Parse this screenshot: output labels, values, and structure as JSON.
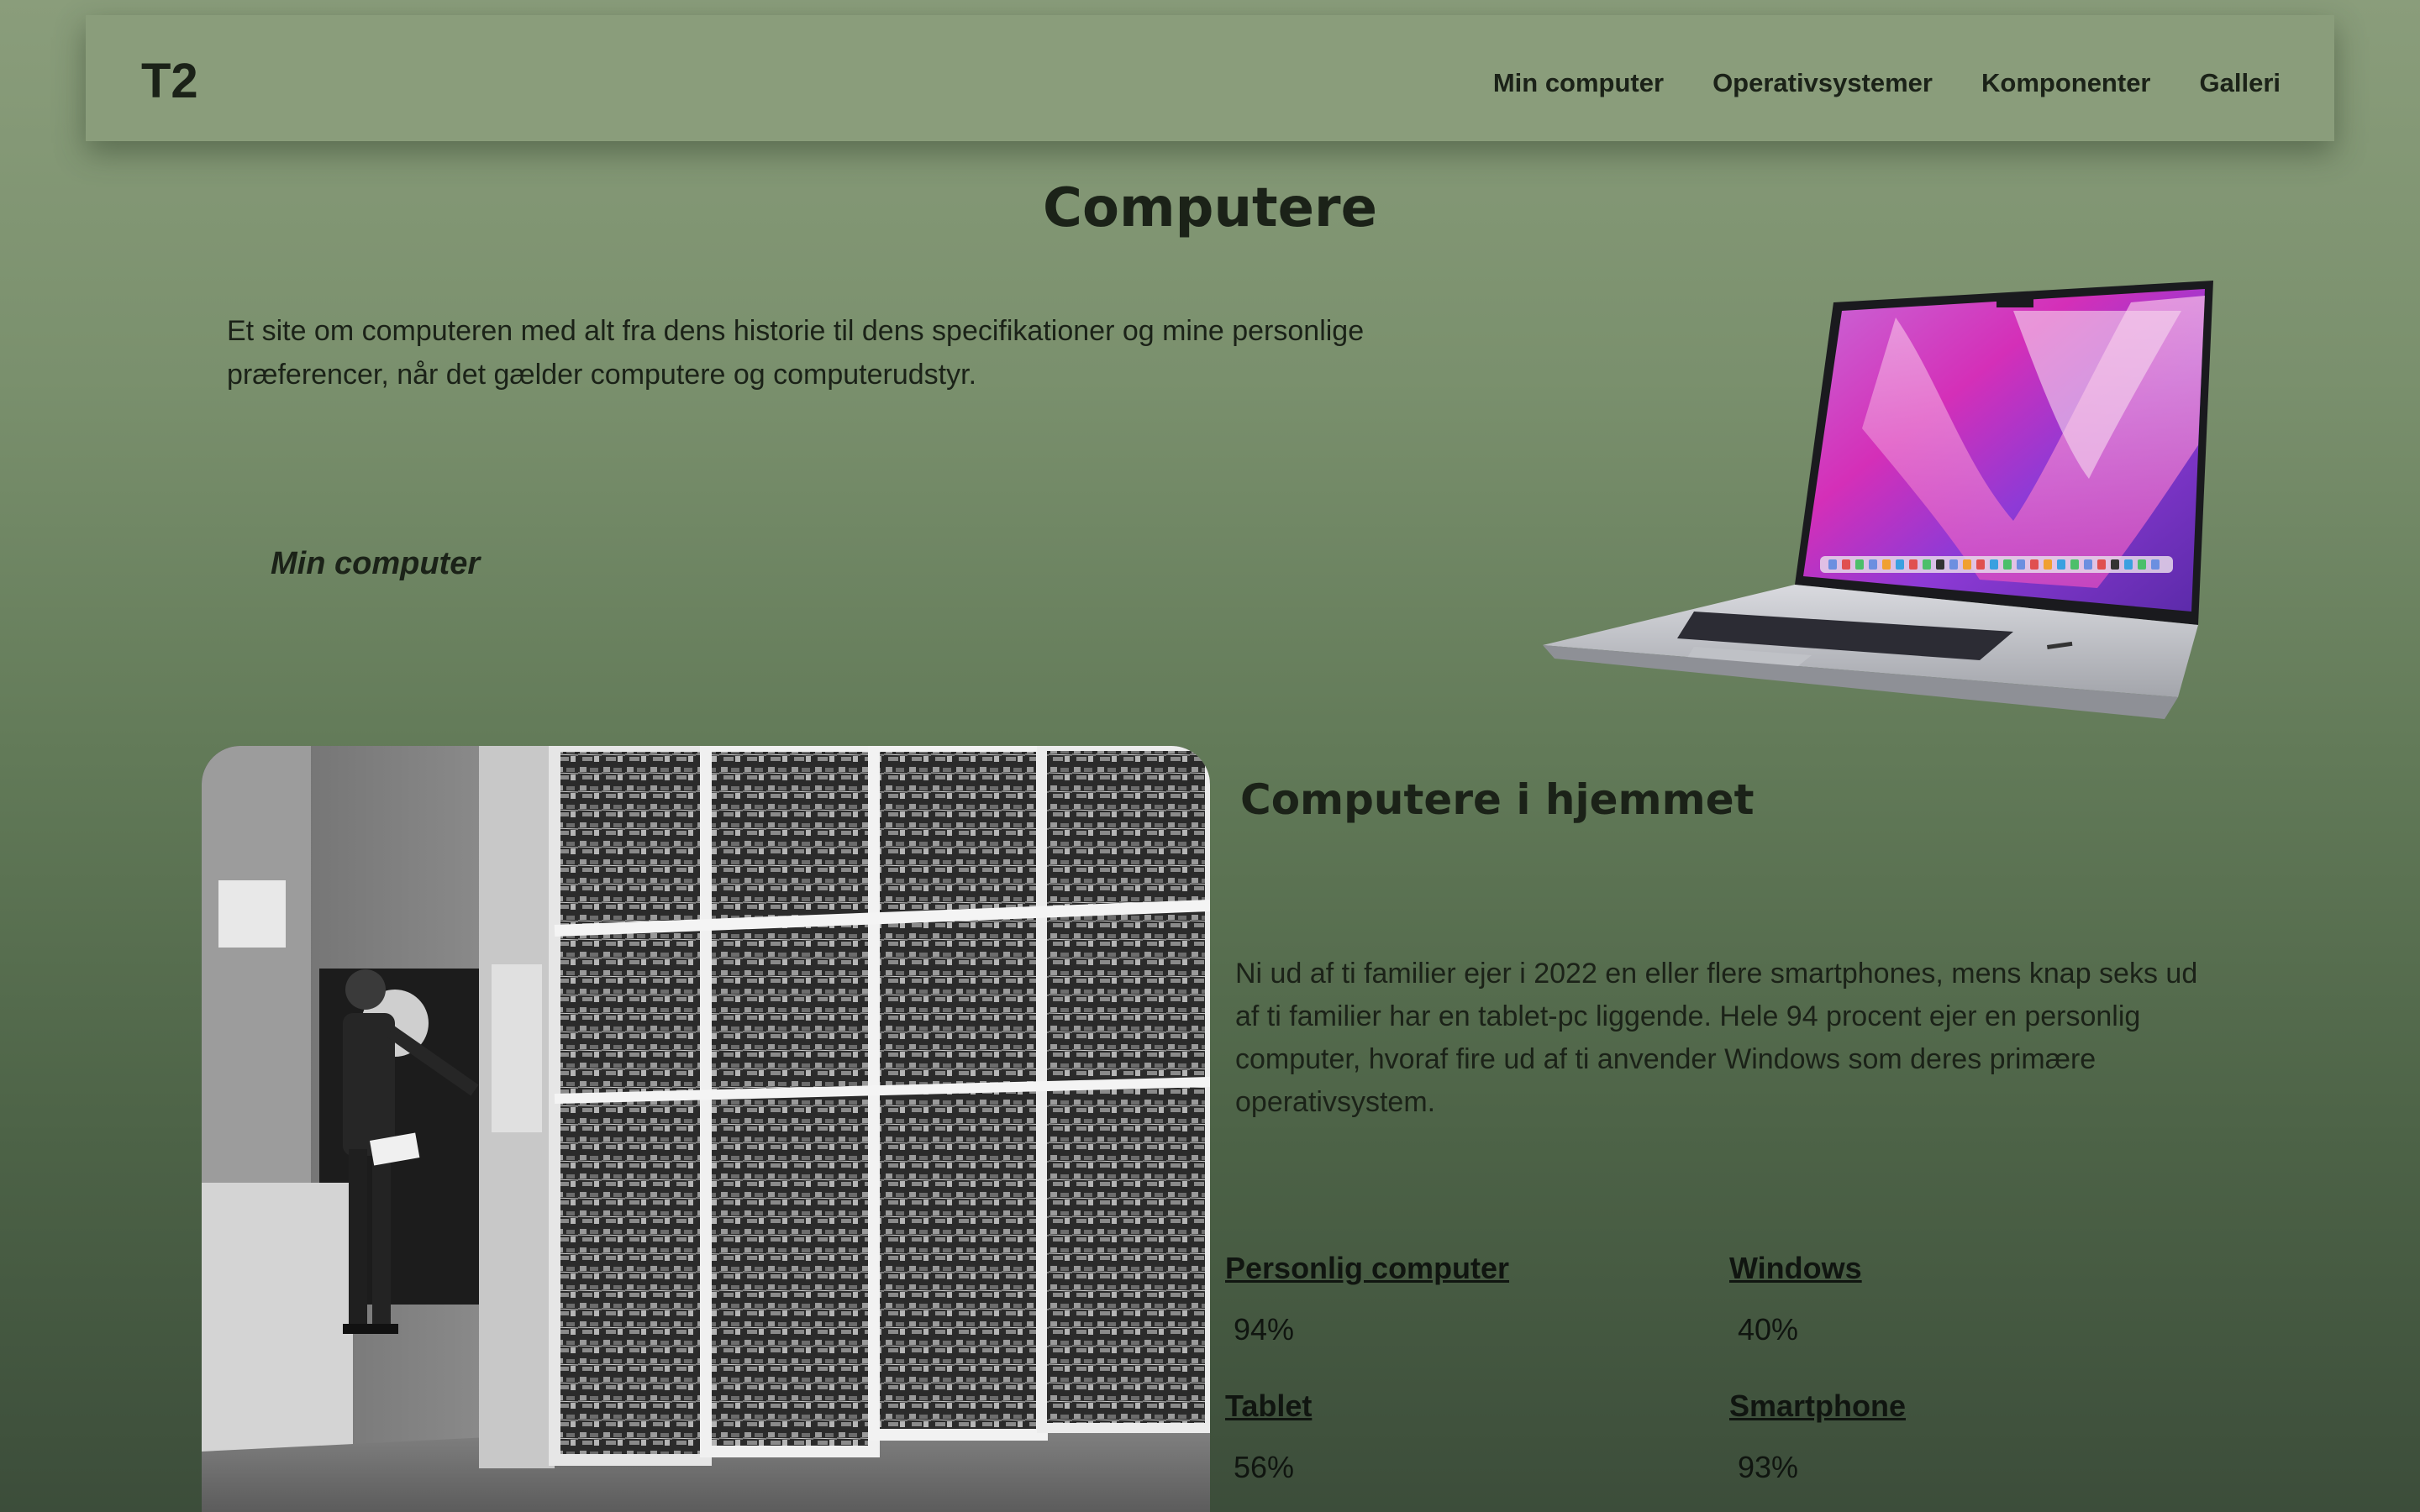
{
  "header": {
    "logo": "T2",
    "nav": [
      {
        "label": "Min computer"
      },
      {
        "label": "Operativsystemer"
      },
      {
        "label": "Komponenter"
      },
      {
        "label": "Galleri"
      }
    ]
  },
  "hero": {
    "title": "Computere",
    "intro": "Et site om computeren med alt fra dens historie til dens specifikationer og mine personlige præferencer, når det gælder computere og computerudstyr.",
    "sub_link": "Min computer"
  },
  "home_section": {
    "title": "Computere i hjemmet",
    "text": "Ni ud af ti familier ejer i 2022 en eller flere smartphones, mens knap seks ud af ti familier har en tablet-pc liggende. Hele 94 procent ejer en personlig computer, hvoraf fire ud af ti anvender Windows som deres primære operativsystem.",
    "stats": [
      {
        "label": "Personlig computer",
        "value": "94%"
      },
      {
        "label": "Windows",
        "value": "40%"
      },
      {
        "label": "Tablet",
        "value": "56%"
      },
      {
        "label": "Smartphone",
        "value": "93%"
      }
    ]
  },
  "colors": {
    "background_top": "#8a9d7b",
    "background_bottom": "#3c4d3a",
    "text": "#1b2218"
  }
}
